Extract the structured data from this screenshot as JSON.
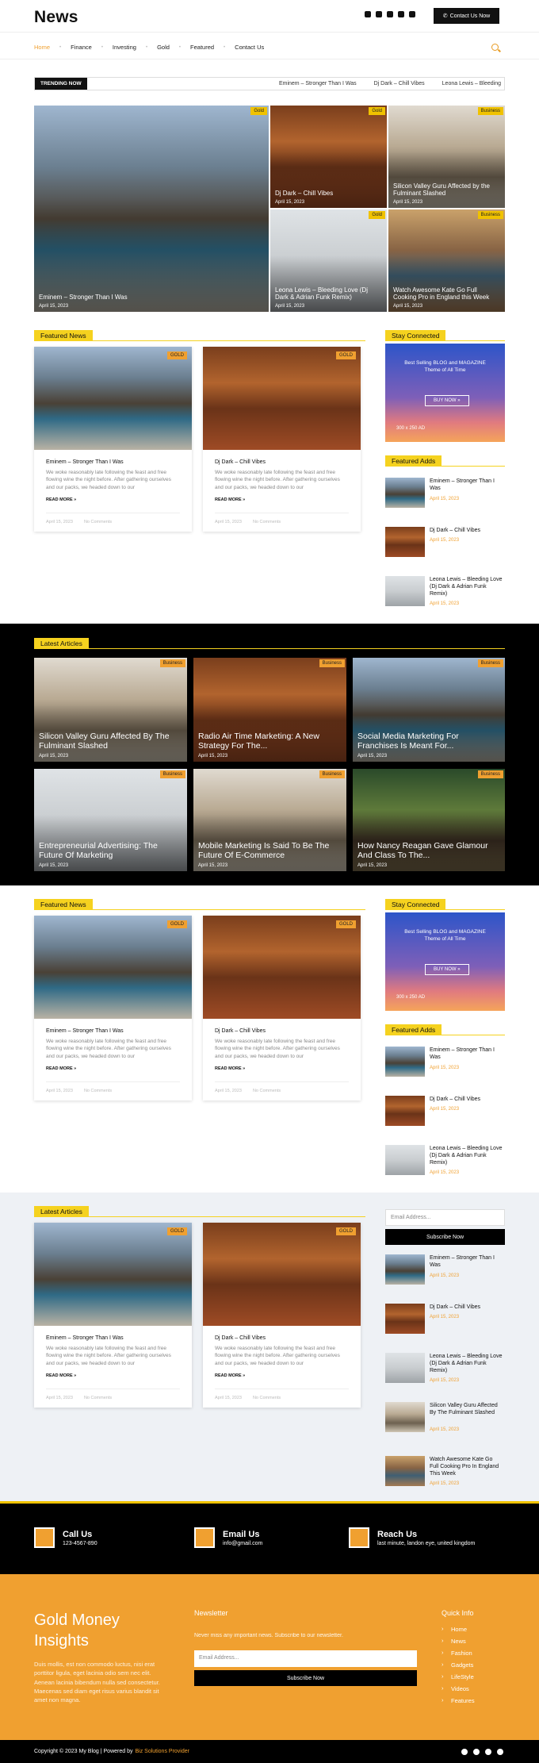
{
  "header": {
    "logo": "News",
    "contact_btn": "Contact Us Now",
    "social": [
      "facebook-icon",
      "instagram-icon",
      "twitter-icon",
      "linkedin-icon",
      "youtube-icon"
    ]
  },
  "nav": {
    "items": [
      "Home",
      "Finance",
      "Investing",
      "Gold",
      "Featured",
      "Contact Us"
    ],
    "active": "Home"
  },
  "trending": {
    "label": "TRENDING NOW",
    "items": [
      "Eminem – Stronger Than I Was",
      "Dj Dark – Chill Vibes",
      "Leona Lewis – Bleeding"
    ]
  },
  "hero": [
    {
      "title": "Eminem – Stronger Than I Was",
      "date": "April 15, 2023",
      "badge": "Gold"
    },
    {
      "title": "Dj Dark – Chill Vibes",
      "date": "April 15, 2023",
      "badge": "Gold"
    },
    {
      "title": "Silicon Valley Guru Affected by the Fulminant Slashed",
      "date": "April 15, 2023",
      "badge": "Business"
    },
    {
      "title": "Leona Lewis – Bleeding Love (Dj Dark & Adrian Funk Remix)",
      "date": "April 15, 2023",
      "badge": "Gold"
    },
    {
      "title": "Watch Awesome Kate Go Full Cooking Pro in England this Week",
      "date": "April 15, 2023",
      "badge": "Business"
    }
  ],
  "featured": {
    "heading": "Featured News",
    "cards": [
      {
        "title": "Eminem – Stronger Than I Was",
        "excerpt": "We woke reasonably late following the feast and free flowing wine the night before. After gathering ourselves and our packs, we headed down to our",
        "read": "READ MORE »",
        "date": "April 15, 2023",
        "comments": "No Comments",
        "badge": "GOLD"
      },
      {
        "title": "Dj Dark – Chill Vibes",
        "excerpt": "We woke reasonably late following the feast and free flowing wine the night before. After gathering ourselves and our packs, we headed down to our",
        "read": "READ MORE »",
        "date": "April 15, 2023",
        "comments": "No Comments",
        "badge": "GOLD"
      }
    ]
  },
  "sidebar": {
    "connected": "Stay Connected",
    "ad_line1": "Best Selling BLOG and MAGAZINE",
    "ad_line2": "Theme of All Time",
    "ad_btn": "BUY NOW »",
    "ad_size": "300 x 250 AD",
    "featured_adds": "Featured Adds",
    "items": [
      {
        "title": "Eminem – Stronger Than I Was",
        "date": "April 15, 2023"
      },
      {
        "title": "Dj Dark – Chill Vibes",
        "date": "April 15, 2023"
      },
      {
        "title": "Leona Lewis – Bleeding Love (Dj Dark & Adrian Funk Remix)",
        "date": "April 15, 2023"
      }
    ]
  },
  "latest_dark": {
    "heading": "Latest Articles",
    "tiles": [
      {
        "title": "Silicon Valley Guru Affected By The Fulminant Slashed",
        "date": "April 15, 2023",
        "badge": "Business"
      },
      {
        "title": "Radio Air Time Marketing: A New Strategy For The...",
        "date": "April 15, 2023",
        "badge": "Business"
      },
      {
        "title": "Social Media Marketing For Franchises Is Meant For...",
        "date": "April 15, 2023",
        "badge": "Business"
      },
      {
        "title": "Entrepreneurial Advertising: The Future Of Marketing",
        "date": "April 15, 2023",
        "badge": "Business"
      },
      {
        "title": "Mobile Marketing Is Said To Be The Future Of E-Commerce",
        "date": "April 15, 2023",
        "badge": "Business"
      },
      {
        "title": "How Nancy Reagan Gave Glamour And Class To The...",
        "date": "April 15, 2023",
        "badge": "Business"
      }
    ]
  },
  "latest_light": {
    "heading": "Latest Articles",
    "email_placeholder": "Email Address...",
    "subscribe": "Subscribe Now",
    "side": [
      {
        "title": "Eminem – Stronger Than I Was",
        "date": "April 15, 2023"
      },
      {
        "title": "Dj Dark – Chill Vibes",
        "date": "April 15, 2023"
      },
      {
        "title": "Leona Lewis – Bleeding Love (Dj Dark & Adrian Funk Remix)",
        "date": "April 15, 2023"
      },
      {
        "title": "Silicon Valley Guru Affected By The Fulminant Slashed",
        "date": "April 15, 2023"
      },
      {
        "title": "Watch Awesome Kate Go Full Cooking Pro In England This Week",
        "date": "April 15, 2023"
      }
    ]
  },
  "contact": [
    {
      "h": "Call Us",
      "s": "123-4567-890"
    },
    {
      "h": "Email Us",
      "s": "info@gmail.com"
    },
    {
      "h": "Reach Us",
      "s": "last minute, landon eye, united kingdom"
    }
  ],
  "footer": {
    "brand": "Gold Money Insights",
    "desc": "Duis mollis, est non commodo luctus, nisi erat porttitor ligula, eget lacinia odio sem nec elit. Aenean lacinia bibendum nulla sed consectetur. Maecenas sed diam eget risus varius blandit sit amet non magna.",
    "nl_title": "Newsletter",
    "nl_desc": "Never miss any important news. Subscribe to our newsletter.",
    "email_placeholder": "Email Address...",
    "subscribe": "Subscribe Now",
    "ql_title": "Quick Info",
    "ql": [
      "Home",
      "News",
      "Fashion",
      "Gadgets",
      "LifeStyle",
      "Videos",
      "Features"
    ],
    "copy": "Copyright © 2023 My Blog | Powered by",
    "copy_link": "Biz Solutions Provider"
  },
  "colors": {
    "accent": "#f0a030",
    "yellow": "#f5d21f"
  }
}
